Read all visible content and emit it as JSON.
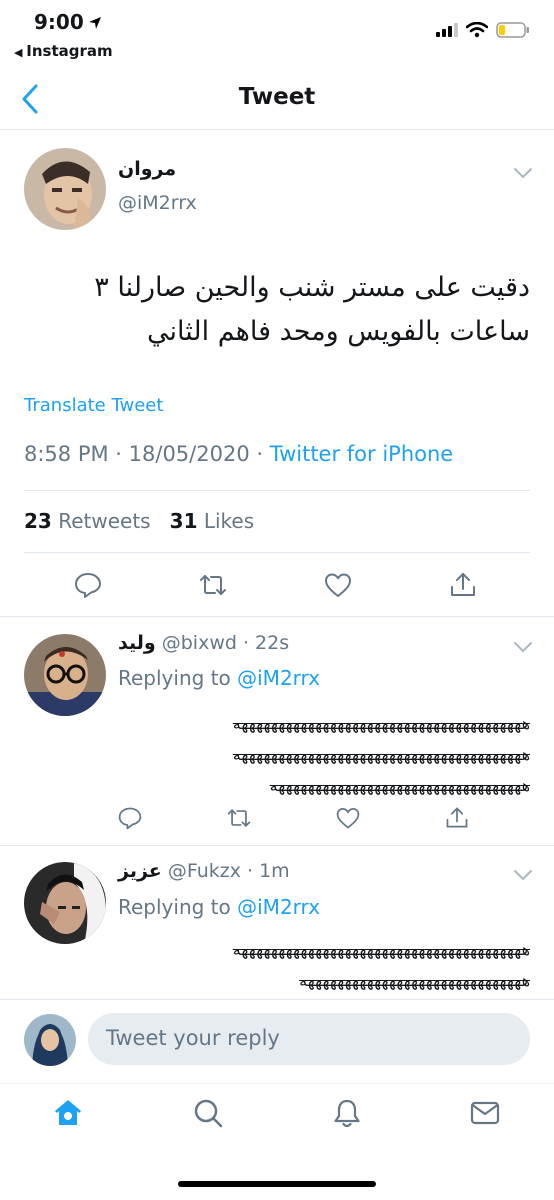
{
  "status_bar": {
    "time": "9:00",
    "back_app": "Instagram"
  },
  "nav": {
    "title": "Tweet"
  },
  "main_tweet": {
    "display_name": "مروان",
    "handle": "@iM2rrx",
    "text_line1": "دقيت على مستر شنب والحين صارلنا ٣",
    "text_line2": "ساعات بالفويس ومحد فاهم الثاني",
    "translate_label": "Translate Tweet",
    "timestamp": "8:58 PM · 18/05/2020 · ",
    "source": "Twitter for iPhone",
    "retweets_count": "23",
    "retweets_label": "Retweets",
    "likes_count": "31",
    "likes_label": "Likes"
  },
  "replies": [
    {
      "display_name": "وليد",
      "handle": "@bixwd",
      "time": "· 22s",
      "replying_label": "Replying to ",
      "replying_to": "@iM2rrx",
      "line1": "هههههههههههههههههههههههههههههههههههههههه",
      "line2": "هههههههههههههههههههههههههههههههههههههههه",
      "line3": "ههههههههههههههههههههههههههههههههههه"
    },
    {
      "display_name": "عزيز",
      "handle": "@Fukzx",
      "time": "· 1m",
      "replying_label": "Replying to ",
      "replying_to": "@iM2rrx",
      "line1": "هههههههههههههههههههههههههههههههههههههههه",
      "line2": "ههههههههههههههههههههههههههههههه"
    }
  ],
  "composer": {
    "placeholder": "Tweet your reply"
  },
  "tab_bar": {
    "icons": [
      "home-icon",
      "search-icon",
      "notifications-icon",
      "messages-icon"
    ]
  },
  "colors": {
    "accent": "#1da1f2",
    "muted": "#657786",
    "divider": "#e1e8ed"
  }
}
